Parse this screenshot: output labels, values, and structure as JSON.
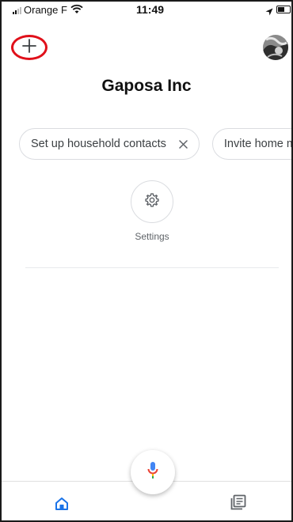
{
  "status_bar": {
    "carrier": "Orange F",
    "time": "11:49",
    "battery_level": 0.55
  },
  "header": {
    "add_icon": "plus-icon",
    "avatar": "account-avatar",
    "home_name": "Gaposa Inc"
  },
  "chips": [
    {
      "label": "Set up household contacts",
      "icon": "close-icon"
    },
    {
      "label": "Invite home me"
    }
  ],
  "shortcuts": [
    {
      "label": "Settings",
      "icon": "gear-icon"
    }
  ],
  "bottom_nav": {
    "items": [
      {
        "name": "home",
        "icon": "home-icon",
        "active": true
      },
      {
        "name": "feed",
        "icon": "feed-icon",
        "active": false
      }
    ],
    "mic_icon": "microphone-icon"
  },
  "colors": {
    "highlight": "#e0101a",
    "active_nav": "#1a73e8",
    "text": "#202124",
    "chip_border": "#dadce0"
  }
}
